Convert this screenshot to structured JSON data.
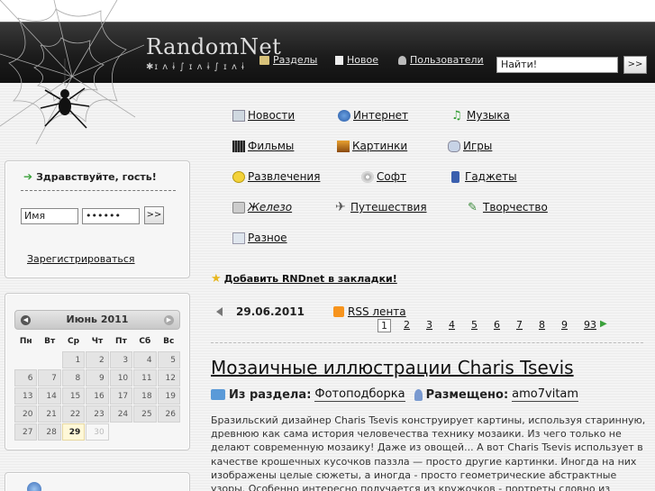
{
  "site": {
    "logo": "RandomNet",
    "logo_figures": "✱ɪ ᴧ ɨ ∫ ɪ ᴧ ɨ ∫ ɪ ᴧ ɨ"
  },
  "topnav": [
    {
      "label": "Разделы",
      "icon": "folder-icon"
    },
    {
      "label": "Новое",
      "icon": "doc-icon"
    },
    {
      "label": "Пользователи",
      "icon": "user-icon"
    }
  ],
  "search": {
    "value": "Найти!",
    "button": ">>"
  },
  "categories": [
    {
      "label": "Новости",
      "icon": "news-icon"
    },
    {
      "label": "Интернет",
      "icon": "globe-icon"
    },
    {
      "label": "Музыка",
      "icon": "music-icon"
    },
    {
      "label": "Фильмы",
      "icon": "film-icon"
    },
    {
      "label": "Картинки",
      "icon": "picture-icon"
    },
    {
      "label": "Игры",
      "icon": "gamepad-icon"
    },
    {
      "label": "Развлечения",
      "icon": "smiley-icon"
    },
    {
      "label": "Софт",
      "icon": "disc-icon"
    },
    {
      "label": "Гаджеты",
      "icon": "phone-icon"
    },
    {
      "label": "Железо",
      "icon": "hardware-icon"
    },
    {
      "label": "Путешествия",
      "icon": "plane-icon"
    },
    {
      "label": "Творчество",
      "icon": "pencil-icon"
    },
    {
      "label": "Разное",
      "icon": "misc-icon"
    }
  ],
  "login": {
    "greeting": "Здравствуйте, гость!",
    "username": "Имя",
    "password": "••••••",
    "submit": ">>",
    "register": "Зарегистрироваться"
  },
  "calendar": {
    "month": "Июнь 2011",
    "weekdays": [
      "Пн",
      "Вт",
      "Ср",
      "Чт",
      "Пт",
      "Сб",
      "Вс"
    ],
    "weeks": [
      [
        "",
        "",
        "1",
        "2",
        "3",
        "4",
        "5"
      ],
      [
        "6",
        "7",
        "8",
        "9",
        "10",
        "11",
        "12"
      ],
      [
        "13",
        "14",
        "15",
        "16",
        "17",
        "18",
        "19"
      ],
      [
        "20",
        "21",
        "22",
        "23",
        "24",
        "25",
        "26"
      ],
      [
        "27",
        "28",
        "29",
        "30",
        "",
        "",
        ""
      ]
    ],
    "today": "29"
  },
  "bookmark": "Добавить RNDnet в закладки!",
  "date": "29.06.2011",
  "rss": "RSS лента",
  "pager": {
    "current": "1",
    "pages": [
      "2",
      "3",
      "4",
      "5",
      "6",
      "7",
      "8",
      "9",
      "93"
    ]
  },
  "post": {
    "title": "Мозаичные иллюстрации Charis Tsevis",
    "section_label": "Из раздела:",
    "section": "Фотоподборка",
    "author_label": "Размещено:",
    "author": "amo7vitam",
    "text": "Бразильский дизайнер Charis Tsevis конструирует картины, используя старинную, древнюю как сама история человечества технику мозаики. Из чего только не делают современную мозаику! Даже из овощей... А вот Charis Tsevis использует в качестве крошечных кусочков паззла — просто другие картинки. Иногда на них изображены целые сюжеты, а иногда - просто геометрические абстрактные узоры. Особенно интересно получается из кружочков - портреты словно из"
  },
  "colors": {
    "header": "#1c1c1c",
    "rss": "#f7941d",
    "today": "#fff8d8"
  }
}
